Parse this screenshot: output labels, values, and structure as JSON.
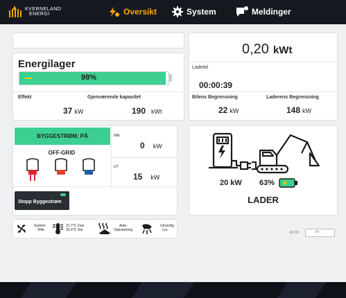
{
  "brand": {
    "line1": "KVERNELAND",
    "line2": "ENERGI"
  },
  "nav": {
    "overview": "Oversikt",
    "system": "System",
    "messages": "Meldinger"
  },
  "battery": {
    "title": "Energilager",
    "percent_label": "98%",
    "fill_fraction": 0.98,
    "effect_label": "Effekt",
    "remaining_label": "Gjenværende kapasitet",
    "effect_value": "37",
    "effect_unit": "kW",
    "remaining_value": "190",
    "remaining_unit": "kWt"
  },
  "charge": {
    "energy_value": "0,20",
    "energy_unit": "kWt",
    "time_label": "Ladetid",
    "time_value": "00:00:39",
    "car_limit_label": "Bilens Begrensning",
    "car_limit_value": "22",
    "car_limit_unit": "kW",
    "charger_limit_label": "Laderens Begrensning",
    "charger_limit_value": "148",
    "charger_limit_unit": "kW"
  },
  "construction": {
    "status_label": "BYGGESTRØM: PÅ",
    "mode_label": "OFF-GRID",
    "in_label": "INN",
    "in_value": "0",
    "in_unit": "kW",
    "out_label": "UT",
    "out_value": "15",
    "out_unit": "kW",
    "stop_button": "Stopp Byggestrøm"
  },
  "charger_panel": {
    "power_value": "20 kW",
    "soc_value": "63%",
    "label": "LADER"
  },
  "status_bar": {
    "fan_line1": "System",
    "fan_line2": "Vifte",
    "temp_line1": "31,7°C Inne",
    "temp_line2": "33,4°C Ute",
    "heat_line1": "Auto-",
    "heat_line2": "Oppvarming",
    "light_line1": "Utvendig",
    "light_line2": "Lys"
  },
  "ev_id": {
    "label": "EV ID",
    "value": "N--"
  },
  "colors": {
    "accent": "#f5a800",
    "battery_green": "#3ccf91",
    "status_green": "#3ccf91",
    "topbar": "#15181f"
  }
}
